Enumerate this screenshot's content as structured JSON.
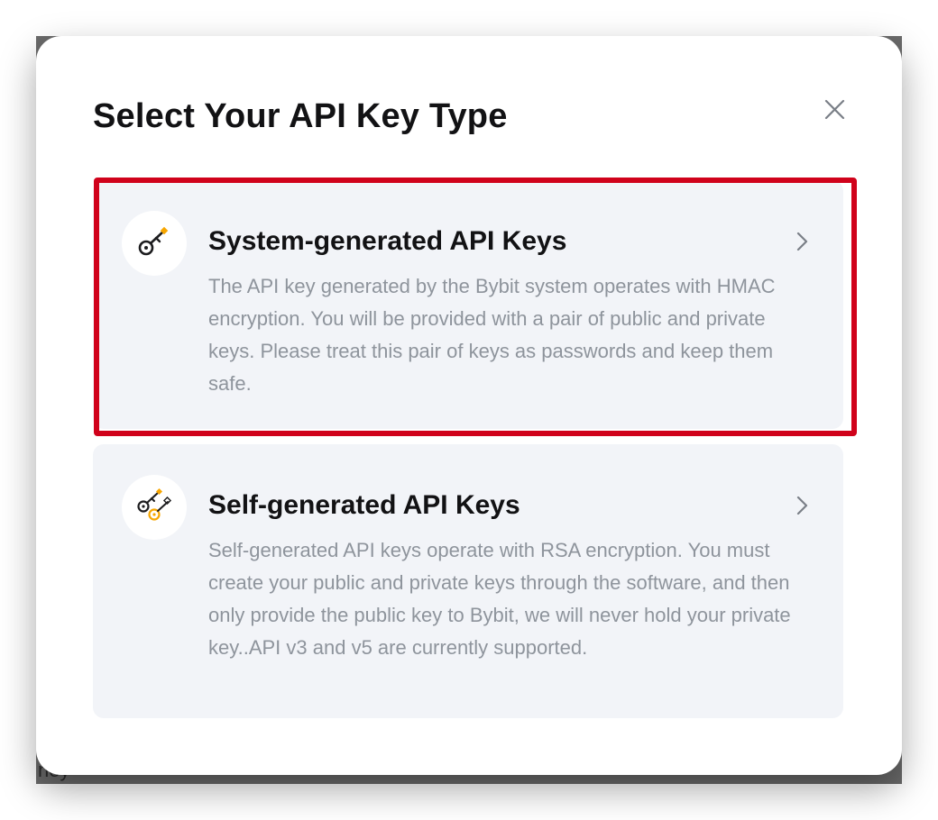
{
  "background": {
    "peek_text": "ney"
  },
  "modal": {
    "title": "Select Your API Key Type",
    "close_icon": "close-icon"
  },
  "options": [
    {
      "title": "System-generated API Keys",
      "description": "The API key generated by the Bybit system operates with HMAC encryption. You will be provided with a pair of public and private keys. Please treat this pair of keys as passwords and keep them safe.",
      "icon": "key-icon",
      "selected": true
    },
    {
      "title": "Self-generated API Keys",
      "description": "Self-generated API keys operate with RSA encryption. You must create your public and private keys through the software, and then only provide the public key to Bybit, we will never hold your private key..API v3 and v5 are currently supported.",
      "icon": "key-pair-icon",
      "selected": false
    }
  ],
  "colors": {
    "highlight": "#d0021b",
    "accent": "#f7a600",
    "card_bg": "#f2f4f8",
    "title_text": "#121214",
    "body_text": "#8e949c"
  }
}
